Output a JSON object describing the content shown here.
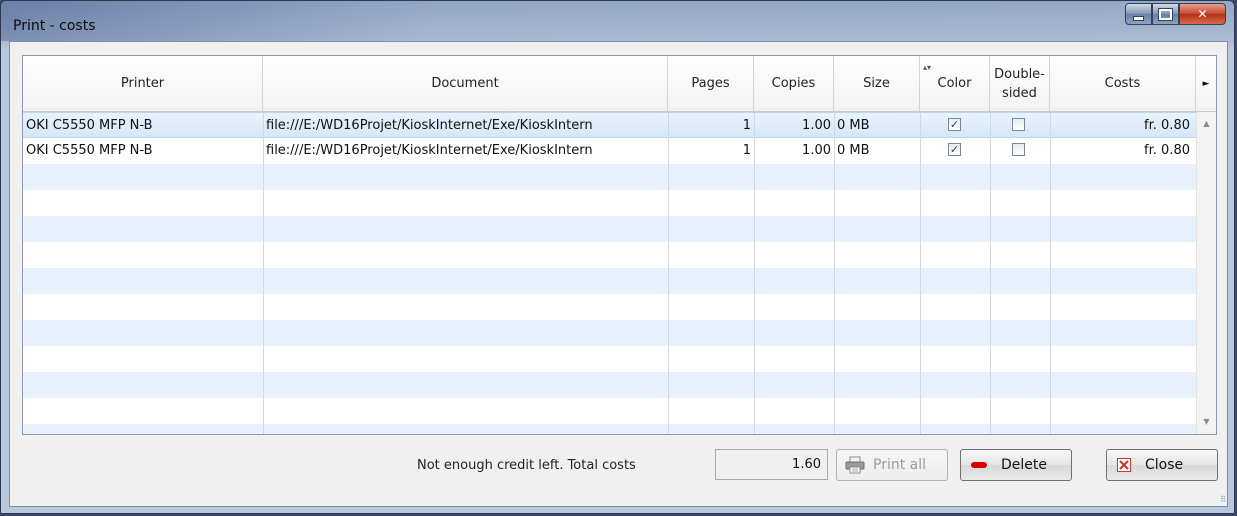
{
  "window": {
    "title": "Print - costs"
  },
  "columns": [
    {
      "key": "printer",
      "label": "Printer"
    },
    {
      "key": "document",
      "label": "Document"
    },
    {
      "key": "pages",
      "label": "Pages"
    },
    {
      "key": "copies",
      "label": "Copies"
    },
    {
      "key": "size",
      "label": "Size"
    },
    {
      "key": "color",
      "label": "Color"
    },
    {
      "key": "double",
      "label": "Double-\nsided"
    },
    {
      "key": "costs",
      "label": "Costs"
    }
  ],
  "rows": [
    {
      "printer": "OKI C5550 MFP N-B",
      "document": "file:///E:/WD16Projet/KioskInternet/Exe/KioskIntern",
      "pages": "1",
      "copies": "1.00",
      "size": "0 MB",
      "color": true,
      "double": false,
      "costs": "fr. 0.80"
    },
    {
      "printer": "OKI C5550 MFP N-B",
      "document": "file:///E:/WD16Projet/KioskInternet/Exe/KioskIntern",
      "pages": "1",
      "copies": "1.00",
      "size": "0 MB",
      "color": true,
      "double": false,
      "costs": "fr. 0.80"
    }
  ],
  "footer": {
    "message": "Not enough credit left. Total costs",
    "total": "1.60",
    "print_all": "Print all",
    "delete": "Delete",
    "close": "Close"
  },
  "icons": {
    "checkmark": "✓",
    "header_scroll_right": "►",
    "scroll_up": "▲",
    "scroll_down": "▼",
    "close_x": "✕"
  },
  "colors": {
    "row_alt": "#e7f1fb",
    "row_selected": "#d5e7f8",
    "close_icon": "#c0392b",
    "delete_icon": "#d40000"
  }
}
